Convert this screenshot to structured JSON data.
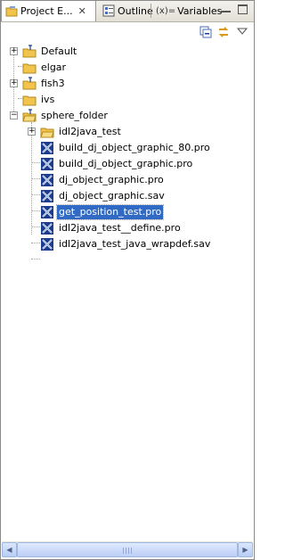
{
  "tabs": [
    {
      "label": "Project E...",
      "icon": "project-explorer-icon",
      "active": true,
      "close": "✕"
    },
    {
      "label": "Outline",
      "icon": "outline-icon",
      "active": false
    },
    {
      "label": "Variables",
      "icon": "variables-icon",
      "active": false,
      "prefix": "(x)="
    }
  ],
  "toolbar": {
    "collapse_all_icon": "collapse-all-icon",
    "link_editor_icon": "link-with-editor-icon",
    "view_menu_icon": "view-menu-icon"
  },
  "tree": {
    "items": [
      {
        "label": "Default",
        "type": "project",
        "expander": "+"
      },
      {
        "label": "elgar",
        "type": "folder",
        "expander": ""
      },
      {
        "label": "fish3",
        "type": "project",
        "expander": "+"
      },
      {
        "label": "ivs",
        "type": "folder",
        "expander": ""
      },
      {
        "label": "sphere_folder",
        "type": "project",
        "expander": "−"
      },
      {
        "label": "idl2java_test",
        "type": "folder",
        "expander": "+"
      },
      {
        "label": "build_dj_object_graphic_80.pro",
        "type": "file"
      },
      {
        "label": "build_dj_object_graphic.pro",
        "type": "file"
      },
      {
        "label": "dj_object_graphic.pro",
        "type": "file"
      },
      {
        "label": "dj_object_graphic.sav",
        "type": "file"
      },
      {
        "label": "get_position_test.pro",
        "type": "file",
        "selected": true
      },
      {
        "label": "idl2java_test__define.pro",
        "type": "file"
      },
      {
        "label": "idl2java_test_java_wrapdef.sav",
        "type": "file"
      }
    ]
  },
  "colors": {
    "selection": "#316ac5",
    "folder": "#f2c44e",
    "file_icon": "#1c3c8c"
  }
}
